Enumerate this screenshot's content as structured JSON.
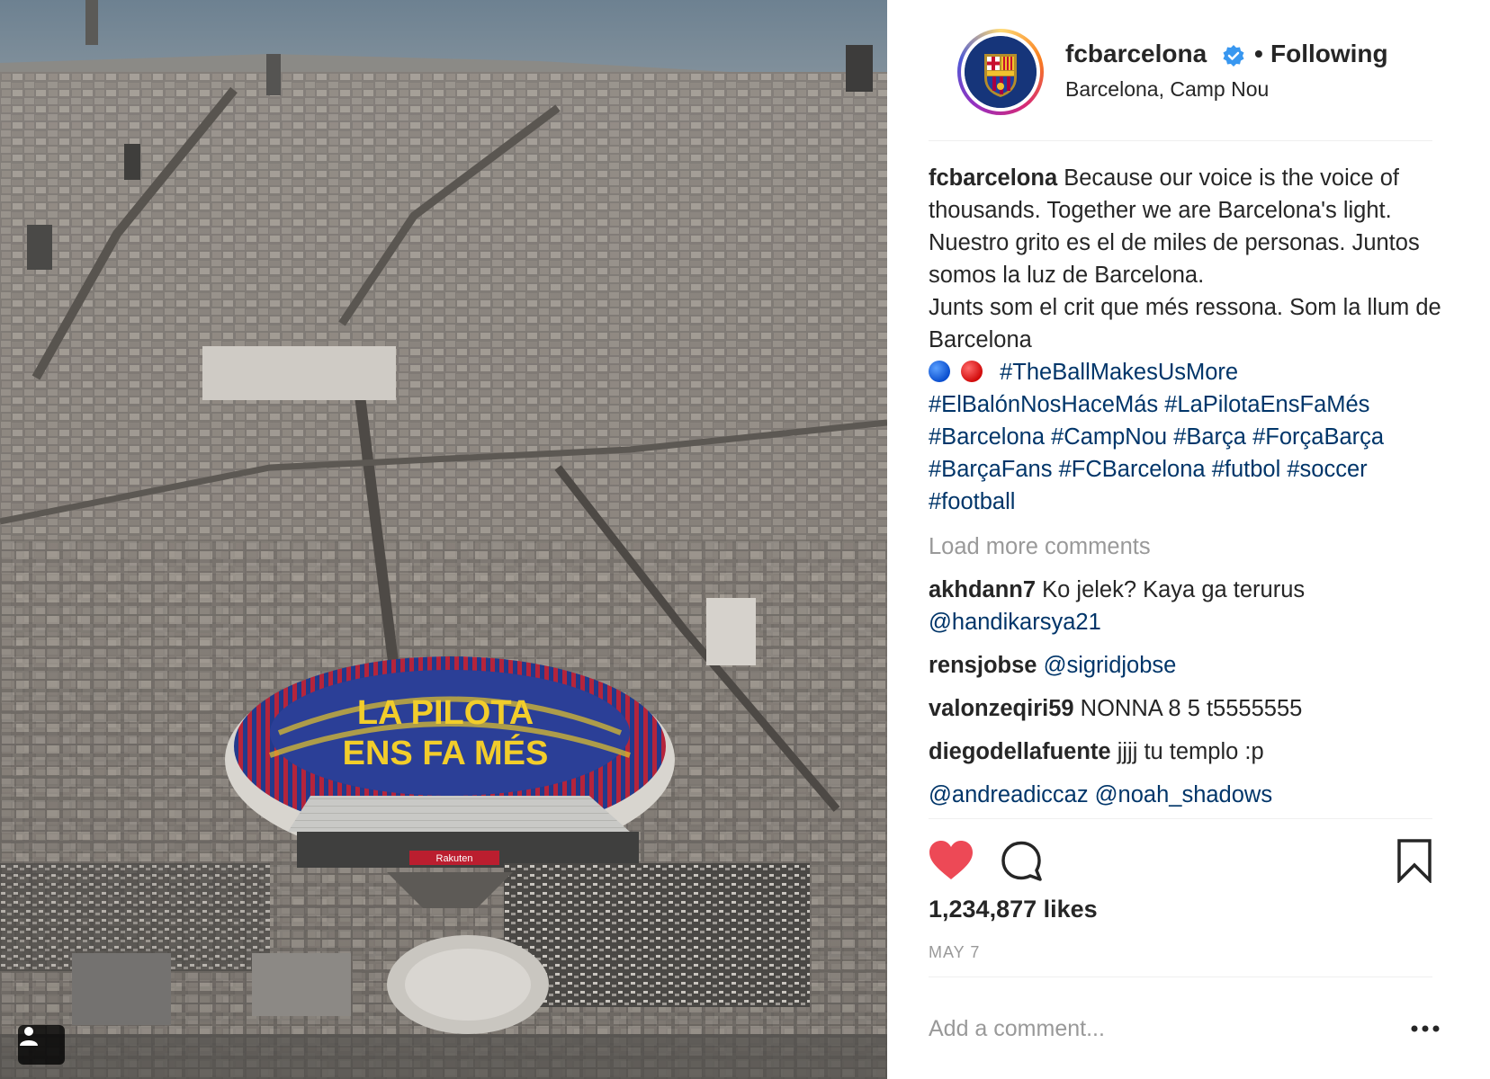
{
  "photo": {
    "alt_banner_line1": "LA PILOTA",
    "alt_banner_line2": "ENS FA MÉS",
    "sponsor": "Rakuten"
  },
  "header": {
    "username": "fcbarcelona",
    "separator": "•",
    "follow_state": "Following",
    "location": "Barcelona, Camp Nou"
  },
  "caption": {
    "username": "fcbarcelona",
    "text_lines": [
      " Because our voice is the voice of thousands. Together we are Barcelona's light.",
      "Nuestro grito es el de miles de personas. Juntos somos la luz de Barcelona.",
      "Junts som el crit que més ressona. Som la llum de Barcelona"
    ],
    "hashtags": [
      "#TheBallMakesUsMore",
      "#ElBalónNosHaceMás",
      "#LaPilotaEnsFaMés",
      "#Barcelona",
      "#CampNou",
      "#Barça",
      "#ForçaBarça",
      "#BarçaFans",
      "#FCBarcelona",
      "#futbol",
      "#soccer",
      "#football"
    ]
  },
  "comments": {
    "load_more": "Load more comments",
    "items": [
      {
        "user": "akhdann7",
        "text": " Ko jelek? Kaya ga terurus ",
        "mention": "@handikarsya21"
      },
      {
        "user": "rensjobse",
        "text": " ",
        "mention": "@sigridjobse"
      },
      {
        "user": "valonzeqiri59",
        "text": " NONNA 8 5 t5555555",
        "mention": ""
      },
      {
        "user": "diegodellafuente",
        "text": " jjjj tu templo :p",
        "mention": ""
      },
      {
        "user": "",
        "text": "",
        "mention": "@andreadiccaz @noah_shadows"
      }
    ]
  },
  "actions": {
    "likes": "1,234,877 likes",
    "date": "MAY 7",
    "add_comment_placeholder": "Add a comment...",
    "like_icon_color": "#ed4956"
  }
}
